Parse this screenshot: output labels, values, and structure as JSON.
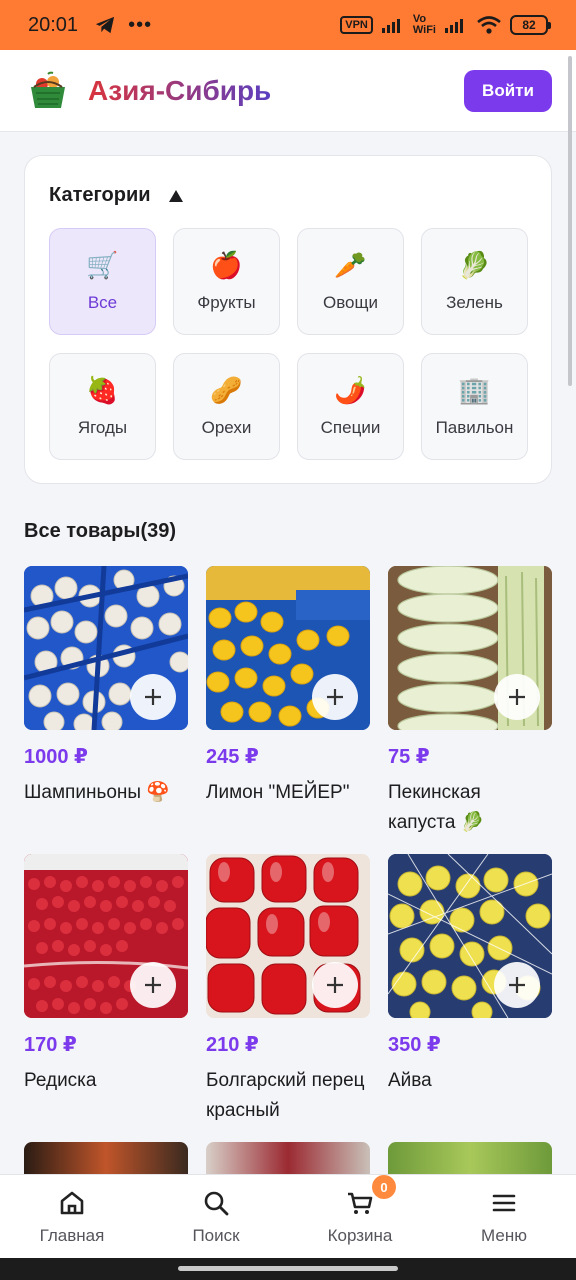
{
  "status_bar": {
    "time": "20:01",
    "dots": "•••",
    "vpn": "VPN",
    "vowifi_top": "Vo",
    "vowifi_bottom": "WiFi",
    "battery": "82"
  },
  "header": {
    "brand": "Азия-Сибирь",
    "login_label": "Войти"
  },
  "categories": {
    "title": "Категории",
    "items": [
      {
        "emoji": "🛒",
        "label": "Все",
        "active": true
      },
      {
        "emoji": "🍎",
        "label": "Фрукты"
      },
      {
        "emoji": "🥕",
        "label": "Овощи"
      },
      {
        "emoji": "🥬",
        "label": "Зелень"
      },
      {
        "emoji": "🍓",
        "label": "Ягоды"
      },
      {
        "emoji": "🥜",
        "label": "Орехи"
      },
      {
        "emoji": "🌶️",
        "label": "Специи"
      },
      {
        "emoji": "🏢",
        "label": "Павильон"
      }
    ]
  },
  "products": {
    "title": "Все товары(39)",
    "items": [
      {
        "price": "1000 ₽",
        "name": "Шампиньоны 🍄"
      },
      {
        "price": "245 ₽",
        "name": "Лимон \"МЕЙЕР\""
      },
      {
        "price": "75 ₽",
        "name": "Пекинская капуста 🥬"
      },
      {
        "price": "170 ₽",
        "name": "Редиска"
      },
      {
        "price": "210 ₽",
        "name": "Болгарский перец красный"
      },
      {
        "price": "350 ₽",
        "name": "Айва"
      }
    ]
  },
  "nav": {
    "home": "Главная",
    "search": "Поиск",
    "cart": "Корзина",
    "cart_count": "0",
    "menu": "Меню"
  },
  "colors": {
    "accent": "#7c3aed",
    "status_bar": "#ff7a33",
    "badge": "#ff8a3d"
  }
}
